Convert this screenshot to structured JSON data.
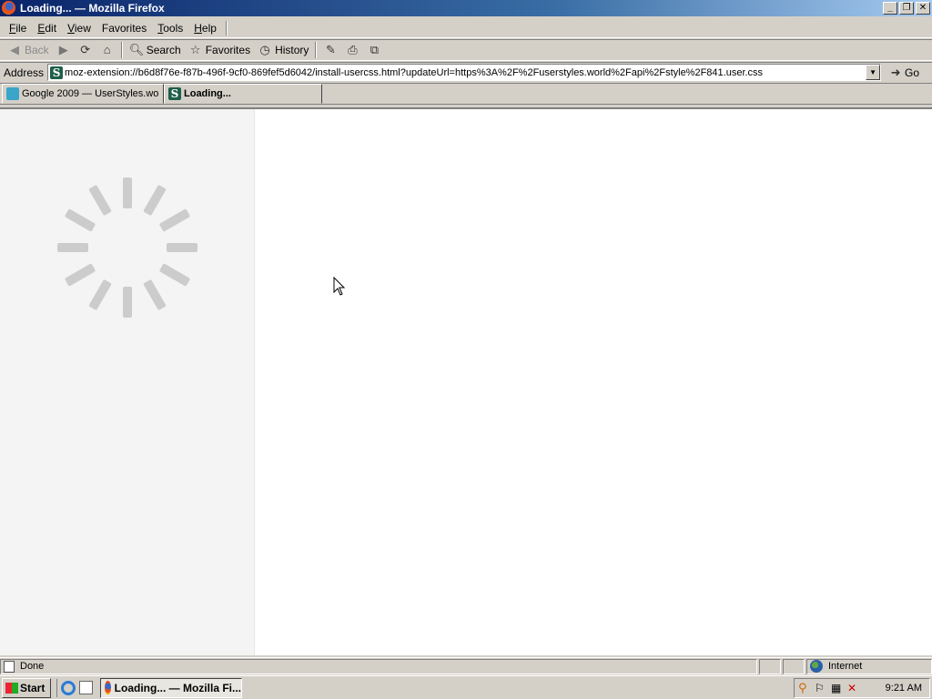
{
  "window": {
    "title": "Loading... — Mozilla Firefox",
    "controls": {
      "minimize": "_",
      "maximize": "❐",
      "close": "✕"
    }
  },
  "menubar": {
    "items": [
      {
        "key": "F",
        "rest": "ile"
      },
      {
        "key": "E",
        "rest": "dit"
      },
      {
        "key": "V",
        "rest": "iew"
      },
      {
        "key": "",
        "rest": "Favorites"
      },
      {
        "key": "T",
        "rest": "ools"
      },
      {
        "key": "H",
        "rest": "elp"
      }
    ]
  },
  "toolbar": {
    "back": "Back",
    "search": "Search",
    "favorites": "Favorites",
    "history": "History"
  },
  "address": {
    "label": "Address",
    "url": "moz-extension://b6d8f76e-f87b-496f-9cf0-869fef5d6042/install-usercss.html?updateUrl=https%3A%2F%2Fuserstyles.world%2Fapi%2Fstyle%2F841.user.css",
    "go": "Go"
  },
  "tabs": [
    {
      "label": "Google 2009 — UserStyles.wo",
      "active": false
    },
    {
      "label": "Loading...",
      "active": true
    }
  ],
  "status": {
    "text": "Done",
    "zone": "Internet"
  },
  "taskbar": {
    "start": "Start",
    "task": "Loading... — Mozilla Fi...",
    "clock": "9:21 AM"
  },
  "colors": {
    "title_gradient_start": "#0a246a",
    "chrome": "#d4d0c8",
    "sidebar_bg": "#f4f4f4",
    "spinner": "#cccccc"
  }
}
